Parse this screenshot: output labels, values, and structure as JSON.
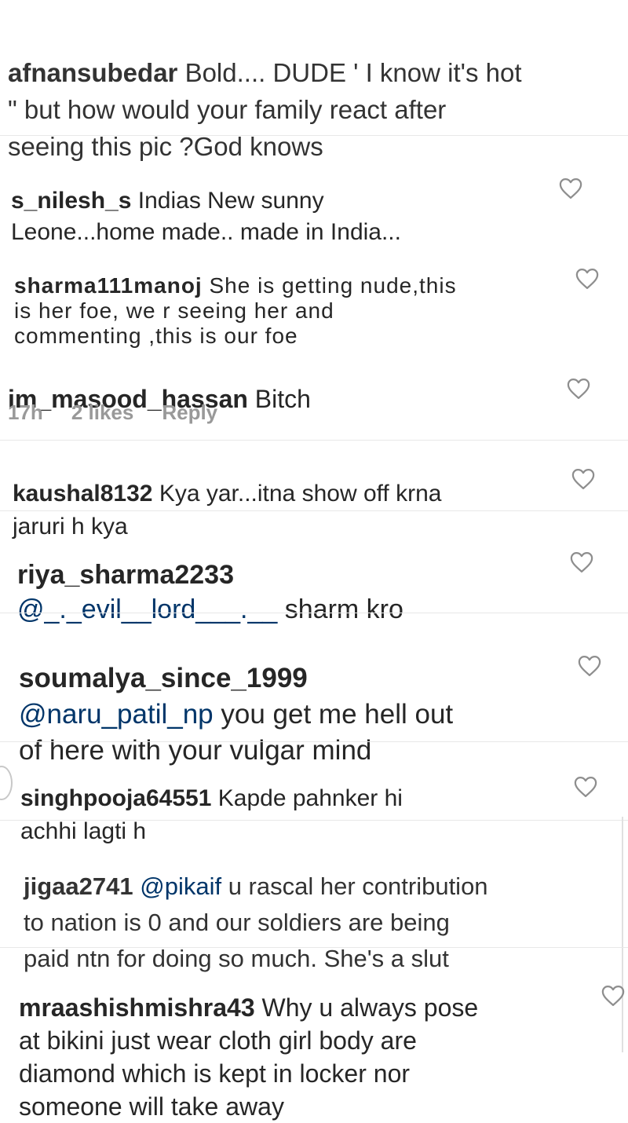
{
  "comments": [
    {
      "username": "afnansubedar",
      "text": "Bold.... DUDE ' I know it's hot\n\" but how would your family react after\nseeing this pic ?God knows"
    },
    {
      "username": "s_nilesh_s",
      "text": "Indias New sunny\nLeone...home made.. made in India..."
    },
    {
      "username": "sharma111manoj",
      "text": "She is getting nude,this\nis her foe, we r seeing her and\ncommenting ,this is our foe"
    },
    {
      "username": "im_masood_hassan",
      "text": "Bitch",
      "time": "17h",
      "likes": "2 likes",
      "reply": "Reply"
    },
    {
      "username": "kaushal8132",
      "text": "Kya yar...itna show off krna\njaruri h kya"
    },
    {
      "username": "riya_sharma2233",
      "mention": "@_._evil__lord___.__",
      "text": "sharm kro"
    },
    {
      "username": "soumalya_since_1999",
      "mention": "@naru_patil_np",
      "text": "you get me hell out\nof here with your vulgar mind"
    },
    {
      "username": "singhpooja64551",
      "text": "Kapde pahnker hi\nachhi lagti h"
    },
    {
      "username": "jigaa2741",
      "mention": "@pikaif",
      "text": "u rascal her contribution\nto nation is 0 and our soldiers are being\npaid ntn for doing so much. She's a slut"
    },
    {
      "username": "mraashishmishra43",
      "text": "Why u always pose\nat bikini just wear cloth girl body are\ndiamond which is kept in locker  nor\nsomeone will take away"
    }
  ],
  "icons": {
    "like": "heart-outline-icon"
  },
  "colors": {
    "text": "#262626",
    "meta": "#999999",
    "mention": "#003569"
  }
}
